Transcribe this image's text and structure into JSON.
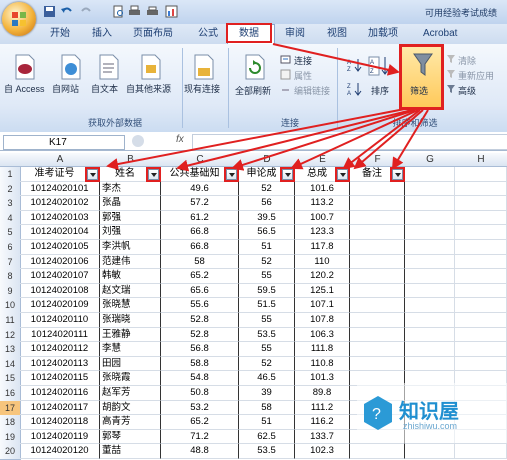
{
  "window": {
    "title": "可用经验考试成绩"
  },
  "tabs": [
    "开始",
    "插入",
    "页面布局",
    "公式",
    "数据",
    "审阅",
    "视图",
    "加载项",
    "Acrobat"
  ],
  "ribbon": {
    "get_external": {
      "buttons": [
        "自 Access",
        "自网站",
        "自文本",
        "自其他来源",
        "现有连接"
      ],
      "label": "获取外部数据"
    },
    "connections": {
      "refresh": "全部刷新",
      "small": [
        "连接",
        "属性",
        "编辑链接"
      ],
      "label": "连接"
    },
    "sort_filter": {
      "sort": "排序",
      "filter": "筛选",
      "small": [
        "清除",
        "重新应用",
        "高级"
      ],
      "label": "排序和筛选"
    }
  },
  "formula_bar": {
    "name_box": "K17",
    "fx": "fx"
  },
  "columns": [
    "A",
    "B",
    "C",
    "D",
    "E",
    "F",
    "G",
    "H"
  ],
  "header_row": [
    "准考证号",
    "姓名",
    "公共基础知",
    "申论成",
    "总成",
    "备注"
  ],
  "rows": [
    [
      "10124020101",
      "李杰",
      "49.6",
      "52",
      "101.6"
    ],
    [
      "10124020102",
      "张晶",
      "57.2",
      "56",
      "113.2"
    ],
    [
      "10124020103",
      "郭强",
      "61.2",
      "39.5",
      "100.7"
    ],
    [
      "10124020104",
      "刘强",
      "66.8",
      "56.5",
      "123.3"
    ],
    [
      "10124020105",
      "李洪帆",
      "66.8",
      "51",
      "117.8"
    ],
    [
      "10124020106",
      "范建伟",
      "58",
      "52",
      "110"
    ],
    [
      "10124020107",
      "韩敏",
      "65.2",
      "55",
      "120.2"
    ],
    [
      "10124020108",
      "赵文瑞",
      "65.6",
      "59.5",
      "125.1"
    ],
    [
      "10124020109",
      "张晓慧",
      "55.6",
      "51.5",
      "107.1"
    ],
    [
      "10124020110",
      "张瑞晓",
      "52.8",
      "55",
      "107.8"
    ],
    [
      "10124020111",
      "王雅静",
      "52.8",
      "53.5",
      "106.3"
    ],
    [
      "10124020112",
      "李慧",
      "56.8",
      "55",
      "111.8"
    ],
    [
      "10124020113",
      "田园",
      "58.8",
      "52",
      "110.8"
    ],
    [
      "10124020115",
      "张晓霞",
      "54.8",
      "46.5",
      "101.3"
    ],
    [
      "10124020116",
      "赵军芳",
      "50.8",
      "39",
      "89.8"
    ],
    [
      "10124020117",
      "胡韵文",
      "53.2",
      "58",
      "111.2"
    ],
    [
      "10124020118",
      "高青芳",
      "65.2",
      "51",
      "116.2"
    ],
    [
      "10124020119",
      "郭琴",
      "71.2",
      "62.5",
      "133.7"
    ],
    [
      "10124020120",
      "董喆",
      "48.8",
      "53.5",
      "102.3"
    ]
  ],
  "watermark": {
    "brand": "知识屋",
    "url": "zhishiwu.com"
  },
  "colors": {
    "highlight": "#e02020",
    "ribbon": "#dfe9f7",
    "accent": "#1e3f73"
  }
}
